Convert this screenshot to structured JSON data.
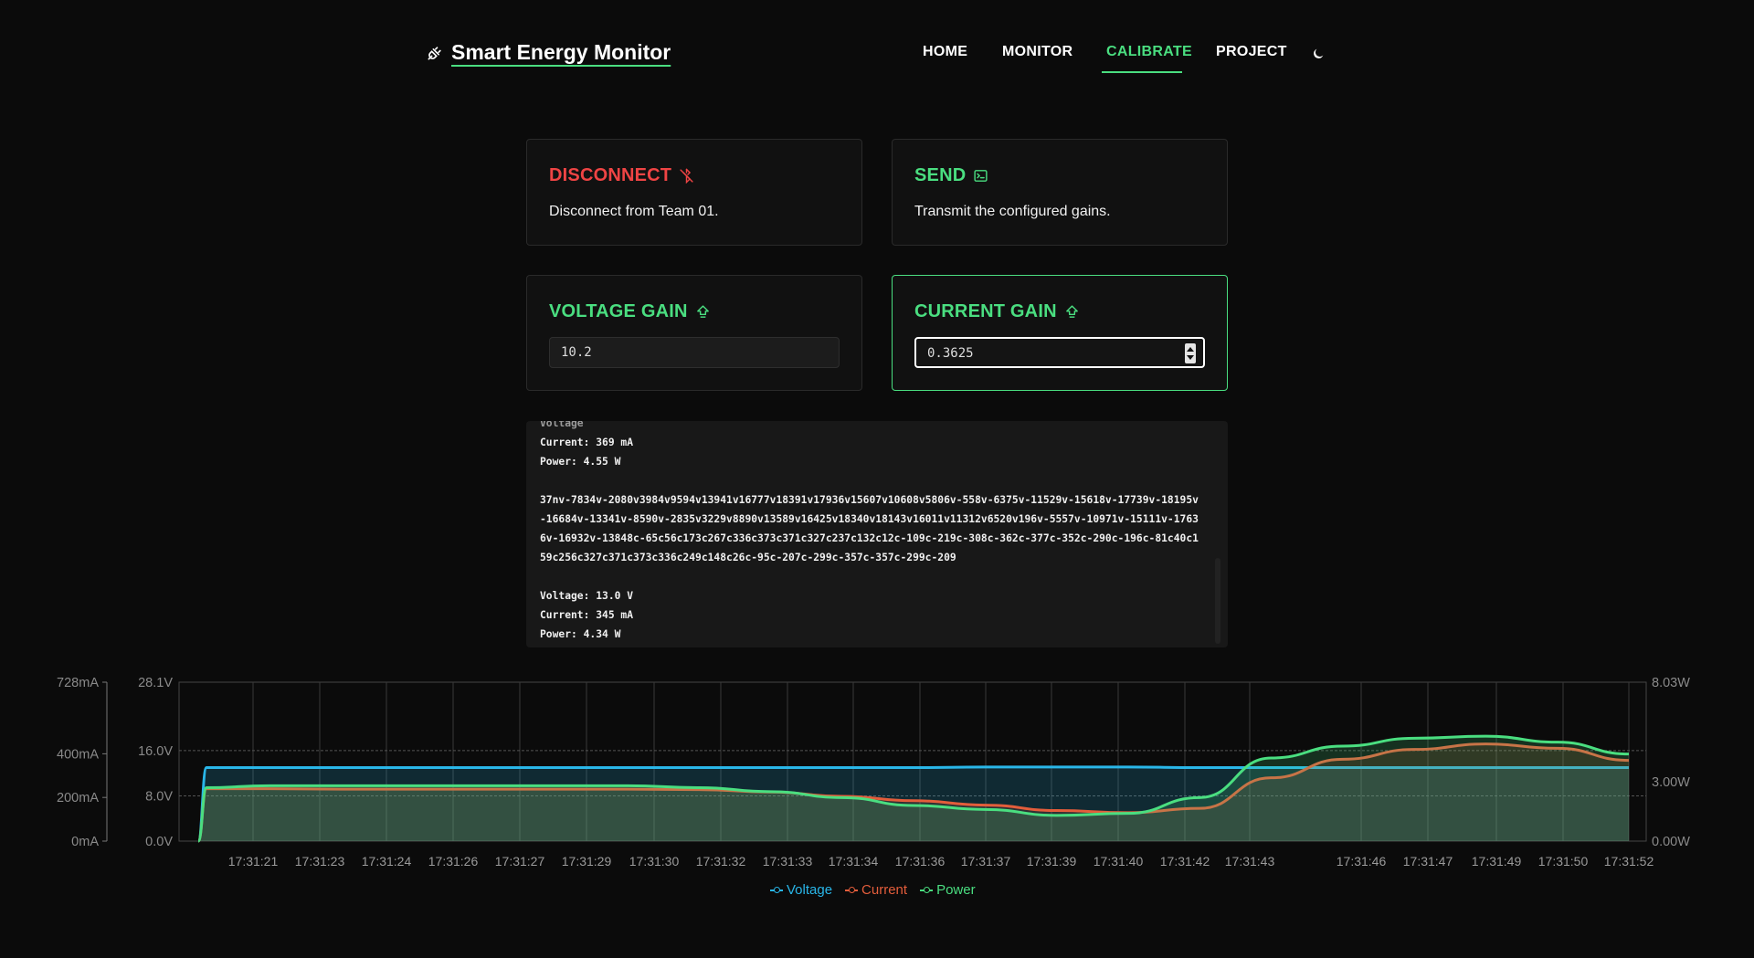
{
  "header": {
    "title": "Smart Energy Monitor",
    "nav": [
      "HOME",
      "MONITOR",
      "CALIBRATE",
      "PROJECT"
    ],
    "active_nav": "CALIBRATE",
    "icons": {
      "logo": "plug-icon",
      "theme": "moon-icon"
    }
  },
  "cards": {
    "disconnect": {
      "title": "DISCONNECT",
      "desc": "Disconnect from Team 01.",
      "icon": "bluetooth-off-icon",
      "color": "#ef4444"
    },
    "send": {
      "title": "SEND",
      "desc": "Transmit the configured gains.",
      "icon": "terminal-icon",
      "color": "#4ade80"
    },
    "voltage_gain": {
      "title": "VOLTAGE GAIN",
      "value": "10.2",
      "icon": "arrow-up-icon"
    },
    "current_gain": {
      "title": "CURRENT GAIN",
      "value": "0.3625",
      "icon": "arrow-up-icon"
    }
  },
  "log": {
    "lines_top": [
      "Current: 369 mA",
      "Power: 4.55 W"
    ],
    "raw": "37nv-7834v-2080v3984v9594v13941v16777v18391v17936v15607v10608v5806v-558v-6375v-11529v-15618v-17739v-18195v-16684v-13341v-8590v-2835v3229v8890v13589v16425v18340v18143v16011v11312v6520v196v-5557v-10971v-15111v-17636v-16932v-13848c-65c56c173c267c336c373c371c327c237c132c12c-109c-219c-308c-362c-377c-352c-290c-196c-81c40c159c256c327c371c373c336c249c148c26c-95c-207c-299c-357c-357c-299c-209",
    "lines_bottom": [
      "Voltage: 13.0 V",
      "Current: 345 mA",
      "Power: 4.34 W"
    ]
  },
  "chart_data": {
    "type": "line",
    "x": [
      "17:31:21",
      "17:31:23",
      "17:31:24",
      "17:31:26",
      "17:31:27",
      "17:31:29",
      "17:31:30",
      "17:31:32",
      "17:31:33",
      "17:31:34",
      "17:31:36",
      "17:31:37",
      "17:31:39",
      "17:31:40",
      "17:31:42",
      "17:31:43",
      "17:31:46",
      "17:31:47",
      "17:31:49",
      "17:31:50",
      "17:31:52"
    ],
    "axes": {
      "current": {
        "ticks": [
          "0mA",
          "200mA",
          "400mA",
          "728mA"
        ],
        "max": 728
      },
      "voltage": {
        "ticks": [
          "0.0V",
          "8.0V",
          "16.0V",
          "28.1V"
        ],
        "max": 28.1
      },
      "power": {
        "ticks": [
          "0.00W",
          "3.00W",
          "8.03W"
        ],
        "max": 8.03
      }
    },
    "series": [
      {
        "name": "Voltage",
        "color": "#29b6e8",
        "axis": "voltage",
        "values": [
          0,
          13.0,
          13.0,
          13.0,
          13.0,
          13.0,
          13.0,
          13.0,
          13.0,
          13.0,
          13.0,
          13.0,
          13.1,
          13.1,
          13.1,
          13.0,
          13.0,
          13.0,
          13.0,
          13.0,
          13.0,
          13.0
        ]
      },
      {
        "name": "Current",
        "color": "#e35d3b",
        "axis": "current",
        "values": [
          0,
          240,
          240,
          238,
          238,
          238,
          238,
          238,
          236,
          225,
          205,
          185,
          165,
          140,
          130,
          150,
          290,
          375,
          420,
          445,
          425,
          370
        ]
      },
      {
        "name": "Power",
        "color": "#4ade80",
        "axis": "power",
        "values": [
          0,
          2.7,
          2.8,
          2.8,
          2.8,
          2.8,
          2.8,
          2.8,
          2.7,
          2.5,
          2.2,
          1.8,
          1.6,
          1.3,
          1.4,
          2.2,
          4.2,
          4.8,
          5.2,
          5.3,
          5.0,
          4.4
        ]
      }
    ],
    "legend": [
      "Voltage",
      "Current",
      "Power"
    ],
    "grid": true
  }
}
